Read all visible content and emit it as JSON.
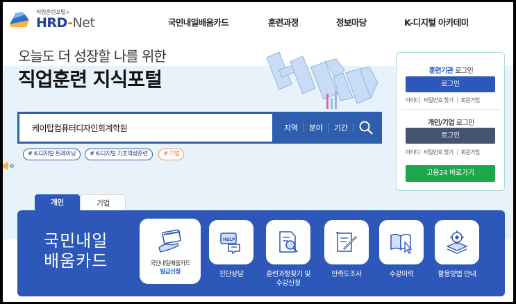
{
  "header": {
    "logo_small": "직업훈련포털",
    "logo_plus": "+",
    "logo_hrd": "HRD",
    "logo_dash": "-",
    "logo_net": "Net",
    "nav": [
      "국민내일배움카드",
      "훈련과정",
      "정보마당",
      "K-디지털 아카데미"
    ]
  },
  "hero": {
    "line1": "오늘도 더 성장할 나를 위한",
    "line2": "직업훈련 지식포털"
  },
  "search": {
    "value": "케이탑컴퓨터디자인회계학원",
    "filters": [
      "지역",
      "분야",
      "기간"
    ]
  },
  "tags": [
    "# K-디지털 트레이닝",
    "# K-디지털 기초역량훈련",
    "# 기업"
  ],
  "login": {
    "org_title_bold": "훈련기관",
    "org_title_rest": " 로그인",
    "org_button": "로그인",
    "org_links": [
      "아이디 · 비밀번호 찾기",
      "회원가입"
    ],
    "user_title_bold": "개인/기업",
    "user_title_rest": " 로그인",
    "user_button": "로그인",
    "user_links": [
      "아이디 · 비밀번호 찾기",
      "회원가입"
    ],
    "goyong_button": "고용24 바로가기"
  },
  "tabs": [
    "개인",
    "기업"
  ],
  "panel": {
    "title_line1": "국민내일",
    "title_line2": "배움카드",
    "card_line1": "국민내일배움카드",
    "card_line2": "발급신청",
    "services": [
      {
        "label": "진단상담",
        "icon": "help-chat-icon"
      },
      {
        "label": "훈련과정찾기 및",
        "label2": "수강신청",
        "icon": "document-search-icon"
      },
      {
        "label": "만족도조사",
        "icon": "survey-pen-icon"
      },
      {
        "label": "수강이력",
        "icon": "book-cursor-icon"
      },
      {
        "label": "활용방법 안내",
        "icon": "gear-stack-icon"
      }
    ]
  },
  "colors": {
    "brand_blue": "#2d57b8",
    "search_blue": "#2e5fae",
    "login_blue": "#2d57b8",
    "login_dark": "#44546e",
    "goyong_green": "#1ea64b",
    "hero_bg": "#e8f2fb"
  }
}
